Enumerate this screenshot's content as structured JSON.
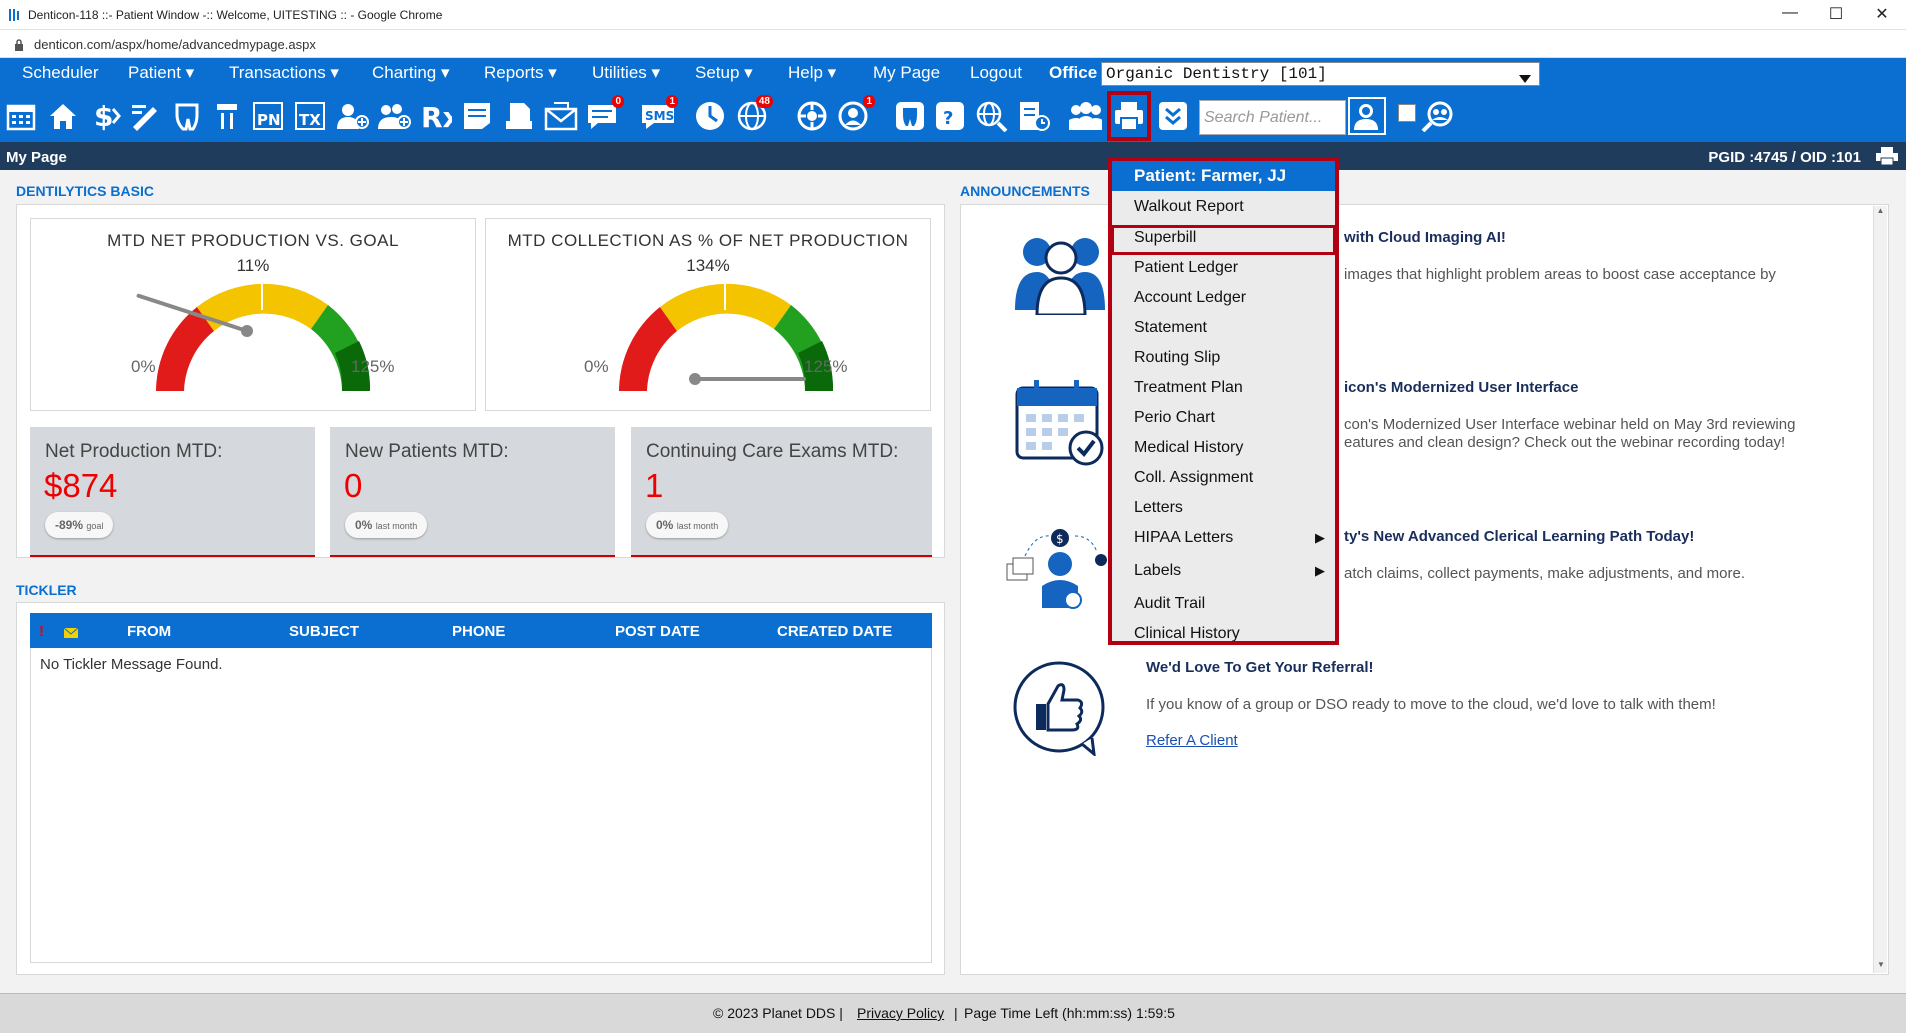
{
  "window": {
    "title": "Denticon-118 ::- Patient Window -:: Welcome, UITESTING :: - Google Chrome",
    "url": "denticon.com/aspx/home/advancedmypage.aspx",
    "minimize": "—",
    "maximize": "☐",
    "close": "✕"
  },
  "menu": {
    "items": [
      "Scheduler",
      "Patient ▾",
      "Transactions ▾",
      "Charting ▾",
      "Reports ▾",
      "Utilities ▾",
      "Setup ▾",
      "Help ▾",
      "My Page",
      "Logout"
    ],
    "office_label": "Office",
    "office_value": "Organic Dentistry [101]"
  },
  "toolbar": {
    "badges": {
      "sms": "1",
      "globe": "48",
      "recall": "1",
      "mail": "0"
    },
    "search_placeholder": "Search Patient..."
  },
  "subbar": {
    "page": "My Page",
    "ids": "PGID :4745  /  OID :101"
  },
  "dentilytics": {
    "heading": "DENTILYTICS BASIC",
    "gauges": [
      {
        "title": "MTD NET PRODUCTION VS. GOAL",
        "value": "11%",
        "min": "0%",
        "max": "125%",
        "level": 0.088
      },
      {
        "title": "MTD COLLECTION AS % OF NET PRODUCTION",
        "value": "134%",
        "min": "0%",
        "max": "125%",
        "level": 1.0
      }
    ],
    "stats": [
      {
        "label": "Net Production MTD:",
        "value": "$874",
        "badge_value": "-89%",
        "badge_unit": "goal"
      },
      {
        "label": "New Patients MTD:",
        "value": "0",
        "badge_value": "0%",
        "badge_unit": "last month"
      },
      {
        "label": "Continuing Care Exams MTD:",
        "value": "1",
        "badge_value": "0%",
        "badge_unit": "last month"
      }
    ]
  },
  "tickler": {
    "heading": "TICKLER",
    "columns": [
      "FROM",
      "SUBJECT",
      "PHONE",
      "POST DATE",
      "CREATED DATE"
    ],
    "flag": "!",
    "empty": "No Tickler Message Found."
  },
  "announcements": {
    "heading": "ANNOUNCEMENTS",
    "items": [
      {
        "title": "with Cloud Imaging AI!",
        "text": "images that highlight problem areas to boost case acceptance by"
      },
      {
        "title": "icon's Modernized User Interface",
        "text1": "con's Modernized User Interface webinar held on May 3rd reviewing",
        "text2": "eatures and clean design? Check out the webinar recording today!"
      },
      {
        "title": "ty's New Advanced Clerical Learning Path Today!",
        "text": "atch claims, collect payments, make adjustments, and more."
      },
      {
        "title": "We'd Love To Get Your Referral!",
        "text": "If you know of a group or DSO ready to move to the cloud, we'd love to talk with them!",
        "link": "Refer A Client"
      }
    ]
  },
  "dropdown": {
    "header": "Patient: Farmer, JJ",
    "items": [
      "Walkout Report",
      "Superbill",
      "Patient Ledger",
      "Account Ledger",
      "Statement",
      "Routing Slip",
      "Treatment Plan",
      "Perio Chart",
      "Medical History",
      "Coll. Assignment",
      "Letters",
      "HIPAA Letters",
      "Labels",
      "Audit Trail",
      "Clinical History"
    ],
    "submenu_arrow": "▶"
  },
  "footer": {
    "copyright": "© 2023 Planet DDS |",
    "privacy": "Privacy Policy",
    "sep": "|",
    "time": "Page Time Left (hh:mm:ss) 1:59:5"
  },
  "colors": {
    "brand_blue": "#0a6fd0",
    "navy": "#1f3c5c",
    "highlight_red": "#b20012",
    "value_red": "#e00000"
  }
}
